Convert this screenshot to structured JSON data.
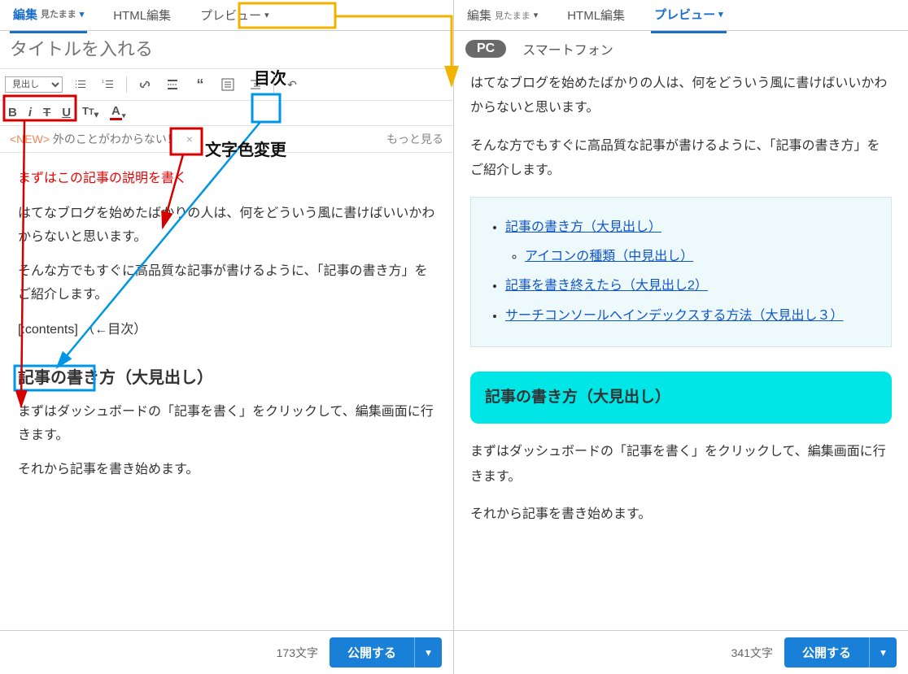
{
  "left": {
    "tabs": {
      "edit_label": "編集",
      "edit_sub": "見たまま",
      "html_label": "HTML編集",
      "preview_label": "プレビュー"
    },
    "title_placeholder": "タイトルを入れる",
    "heading_select_label": "見出し",
    "news": {
      "tag": "<NEW>",
      "text": "外のことがわからない！",
      "close": "×",
      "more": "もっと見る"
    },
    "content": {
      "redline": "まずはこの記事の説明を書く",
      "p1": "はてなブログを始めたばかりの人は、何をどういう風に書けばいいかわからないと思います。",
      "p2": "そんな方でもすぐに高品質な記事が書けるように、「記事の書き方」をご紹介します。",
      "toc_code": "[:contents]",
      "toc_note": "（←目次）",
      "h2": "記事の書き方（大見出し）",
      "p3": "まずはダッシュボードの「記事を書く」をクリックして、編集画面に行きます。",
      "p4": "それから記事を書き始めます。"
    },
    "footer": {
      "count": "173文字",
      "publish": "公開する"
    }
  },
  "right": {
    "tabs": {
      "edit_label": "編集",
      "edit_sub": "見たまま",
      "html_label": "HTML編集",
      "preview_label": "プレビュー"
    },
    "subtabs": {
      "pc": "PC",
      "sp": "スマートフォン"
    },
    "body": {
      "p1": "はてなブログを始めたばかりの人は、何をどういう風に書けばいいかわからないと思います。",
      "p2": "そんな方でもすぐに高品質な記事が書けるように、「記事の書き方」をご紹介します。",
      "toc": {
        "l1": "記事の書き方（大見出し）",
        "l1a": "アイコンの種類（中見出し）",
        "l2": "記事を書き終えたら（大見出し2）",
        "l3": "サーチコンソールへインデックスする方法（大見出し３）"
      },
      "h2": "記事の書き方（大見出し）",
      "p3": "まずはダッシュボードの「記事を書く」をクリックして、編集画面に行きます。",
      "p4": "それから記事を書き始めます。"
    },
    "footer": {
      "count": "341文字",
      "publish": "公開する"
    }
  },
  "annotations": {
    "mokuji_label": "目次",
    "color_label": "文字色変更"
  }
}
